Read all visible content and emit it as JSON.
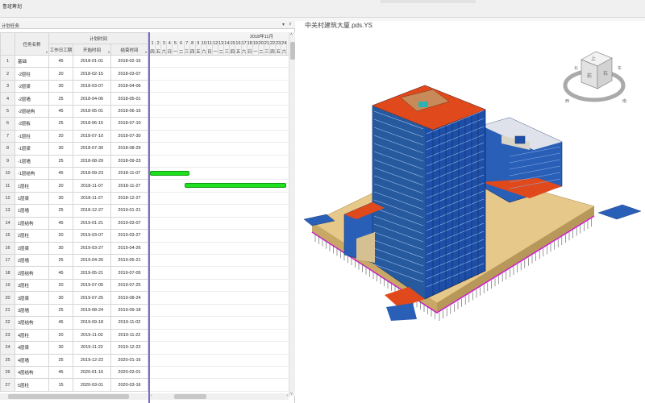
{
  "app": {
    "title": "鲁班筹划",
    "search_placeholder": ""
  },
  "plan_panel": {
    "title": "计划任务",
    "buttons": {
      "dropdown": "▾",
      "pin": "ᵖ"
    },
    "headers": {
      "name": "任务名称",
      "group": "计划时间",
      "duration": "工作日工期",
      "start": "开始时间",
      "end": "结束时间"
    },
    "tasks": [
      {
        "id": "1",
        "name": "基础",
        "dur": "45",
        "start": "2018-01-01",
        "end": "2018-02-15"
      },
      {
        "id": "2",
        "name": "-2层柱",
        "dur": "20",
        "start": "2018-02-15",
        "end": "2018-03-07"
      },
      {
        "id": "3",
        "name": "-2层梁",
        "dur": "30",
        "start": "2018-03-07",
        "end": "2018-04-06"
      },
      {
        "id": "4",
        "name": "-2层墙",
        "dur": "25",
        "start": "2018-04-06",
        "end": "2018-05-01"
      },
      {
        "id": "5",
        "name": "-2层结构",
        "dur": "45",
        "start": "2018-05-01",
        "end": "2018-06-15"
      },
      {
        "id": "6",
        "name": "-2层板",
        "dur": "25",
        "start": "2018-06-15",
        "end": "2018-07-10"
      },
      {
        "id": "7",
        "name": "-1层柱",
        "dur": "20",
        "start": "2018-07-10",
        "end": "2018-07-30"
      },
      {
        "id": "8",
        "name": "-1层梁",
        "dur": "30",
        "start": "2018-07-30",
        "end": "2018-08-29"
      },
      {
        "id": "9",
        "name": "-1层墙",
        "dur": "25",
        "start": "2018-08-29",
        "end": "2018-09-23"
      },
      {
        "id": "10",
        "name": "-1层结构",
        "dur": "45",
        "start": "2018-09-23",
        "end": "2018-11-07"
      },
      {
        "id": "11",
        "name": "1层柱",
        "dur": "20",
        "start": "2018-11-07",
        "end": "2018-11-27"
      },
      {
        "id": "12",
        "name": "1层梁",
        "dur": "30",
        "start": "2018-11-27",
        "end": "2018-12-27"
      },
      {
        "id": "13",
        "name": "1层墙",
        "dur": "25",
        "start": "2018-12-27",
        "end": "2019-01-21"
      },
      {
        "id": "14",
        "name": "1层结构",
        "dur": "45",
        "start": "2019-01-21",
        "end": "2019-03-07"
      },
      {
        "id": "15",
        "name": "2层柱",
        "dur": "20",
        "start": "2019-03-07",
        "end": "2019-03-27"
      },
      {
        "id": "16",
        "name": "2层梁",
        "dur": "30",
        "start": "2019-03-27",
        "end": "2019-04-26"
      },
      {
        "id": "17",
        "name": "2层墙",
        "dur": "25",
        "start": "2019-04-26",
        "end": "2019-05-21"
      },
      {
        "id": "18",
        "name": "2层结构",
        "dur": "45",
        "start": "2019-05-21",
        "end": "2019-07-05"
      },
      {
        "id": "19",
        "name": "3层柱",
        "dur": "20",
        "start": "2019-07-05",
        "end": "2019-07-25"
      },
      {
        "id": "20",
        "name": "3层梁",
        "dur": "30",
        "start": "2019-07-25",
        "end": "2019-08-24"
      },
      {
        "id": "21",
        "name": "3层墙",
        "dur": "25",
        "start": "2019-08-24",
        "end": "2019-09-18"
      },
      {
        "id": "22",
        "name": "3层结构",
        "dur": "45",
        "start": "2019-09-18",
        "end": "2019-11-02"
      },
      {
        "id": "23",
        "name": "4层柱",
        "dur": "20",
        "start": "2019-11-02",
        "end": "2019-11-22"
      },
      {
        "id": "24",
        "name": "4层梁",
        "dur": "30",
        "start": "2019-11-22",
        "end": "2019-12-22"
      },
      {
        "id": "25",
        "name": "4层墙",
        "dur": "25",
        "start": "2019-12-22",
        "end": "2020-01-16"
      },
      {
        "id": "26",
        "name": "4层结构",
        "dur": "45",
        "start": "2020-01-16",
        "end": "2020-03-01"
      },
      {
        "id": "27",
        "name": "5层柱",
        "dur": "15",
        "start": "2020-03-01",
        "end": "2020-03-16"
      }
    ]
  },
  "gantt": {
    "month": "2018年11月",
    "days": [
      "1",
      "2",
      "3",
      "4",
      "5",
      "6",
      "7",
      "8",
      "9",
      "10",
      "11",
      "12",
      "13",
      "14",
      "15",
      "16",
      "17",
      "18",
      "19",
      "20",
      "21",
      "22",
      "23",
      "24"
    ],
    "weekdays": [
      "四",
      "五",
      "六",
      "日",
      "一",
      "二",
      "三",
      "四",
      "五",
      "六",
      "日",
      "一",
      "二",
      "三",
      "四",
      "五",
      "六",
      "日",
      "一",
      "二",
      "三",
      "四",
      "五",
      "六"
    ],
    "bars": [
      {
        "row": 10,
        "from_day": 1,
        "to_day": 7,
        "color": "#1ee01e"
      },
      {
        "row": 11,
        "from_day": 7,
        "to_day": 24,
        "color": "#1ee01e"
      }
    ],
    "scroll_arrows": {
      "left": "‹",
      "right": "›",
      "up": "˄",
      "down": "˅"
    }
  },
  "viewport": {
    "title": "中关村建筑大厦.pds.YS",
    "viewcube": {
      "top": "上",
      "front": "前",
      "right": "右",
      "compass": [
        "北",
        "东",
        "南",
        "西"
      ]
    },
    "colors": {
      "facade": "#1e4fa8",
      "roof": "#e0491c",
      "podium": "#e6c88a",
      "outline": "#cc22cc"
    }
  }
}
